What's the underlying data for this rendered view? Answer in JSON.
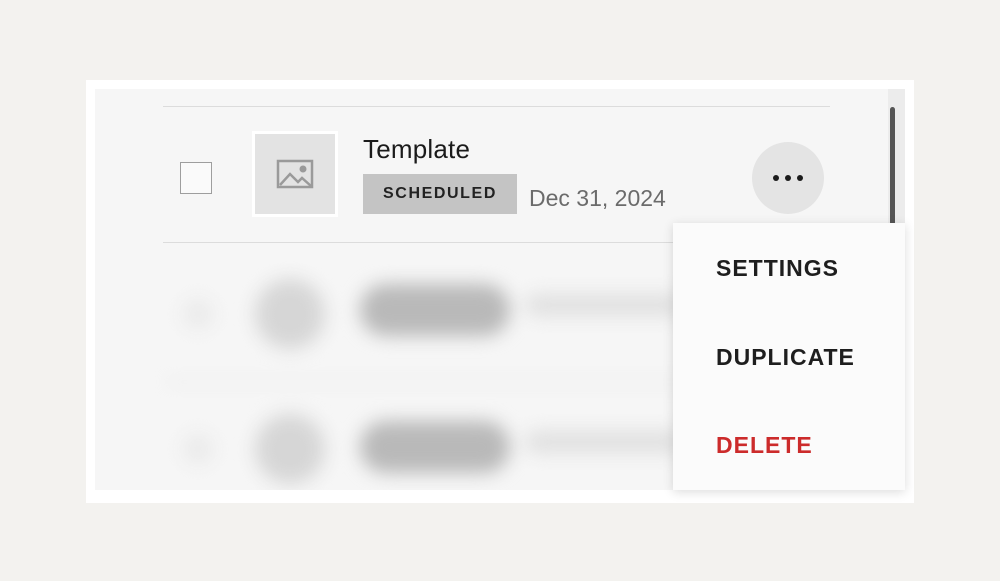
{
  "row": {
    "title": "Template",
    "status_badge": "SCHEDULED",
    "date": "Dec 31, 2024",
    "thumbnail_icon": "image-placeholder-icon",
    "more_icon": "more-horizontal-icon"
  },
  "menu": {
    "items": [
      {
        "label": "SETTINGS"
      },
      {
        "label": "DUPLICATE"
      },
      {
        "label": "DELETE",
        "color": "#cc2b2b"
      }
    ]
  },
  "colors": {
    "badge_bg": "#c4c4c4",
    "danger": "#cc2b2b"
  }
}
